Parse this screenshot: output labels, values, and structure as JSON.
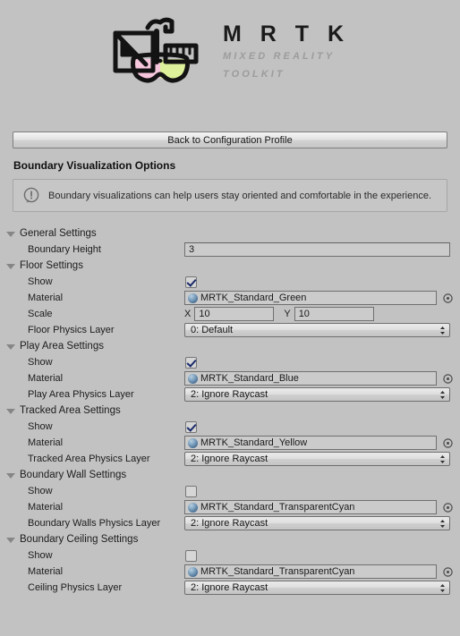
{
  "header": {
    "logo_icon": "mrtk-logo-icon",
    "wordmark": "M R T K",
    "tagline_line1": "MIXED REALITY",
    "tagline_line2": "TOOLKIT"
  },
  "toolbar": {
    "back_button_label": "Back to Configuration Profile"
  },
  "page_title": "Boundary Visualization Options",
  "help": {
    "icon": "info-exclamation-icon",
    "message": "Boundary visualizations can help users stay oriented and comfortable in the experience."
  },
  "sections": [
    {
      "title": "General Settings",
      "rows": [
        {
          "label": "Boundary Height",
          "type": "text",
          "value": "3"
        }
      ]
    },
    {
      "title": "Floor Settings",
      "rows": [
        {
          "label": "Show",
          "type": "checkbox",
          "checked": true
        },
        {
          "label": "Material",
          "type": "object",
          "value": "MRTK_Standard_Green"
        },
        {
          "label": "Scale",
          "type": "vector2",
          "x_label": "X",
          "x_value": "10",
          "y_label": "Y",
          "y_value": "10"
        },
        {
          "label": "Floor Physics Layer",
          "type": "dropdown",
          "value": "0: Default"
        }
      ]
    },
    {
      "title": "Play Area Settings",
      "rows": [
        {
          "label": "Show",
          "type": "checkbox",
          "checked": true
        },
        {
          "label": "Material",
          "type": "object",
          "value": "MRTK_Standard_Blue"
        },
        {
          "label": "Play Area Physics Layer",
          "type": "dropdown",
          "value": "2: Ignore Raycast"
        }
      ]
    },
    {
      "title": "Tracked Area Settings",
      "rows": [
        {
          "label": "Show",
          "type": "checkbox",
          "checked": true
        },
        {
          "label": "Material",
          "type": "object",
          "value": "MRTK_Standard_Yellow"
        },
        {
          "label": "Tracked Area Physics Layer",
          "type": "dropdown",
          "value": "2: Ignore Raycast"
        }
      ]
    },
    {
      "title": "Boundary Wall Settings",
      "rows": [
        {
          "label": "Show",
          "type": "checkbox",
          "checked": false
        },
        {
          "label": "Material",
          "type": "object",
          "value": "MRTK_Standard_TransparentCyan"
        },
        {
          "label": "Boundary Walls Physics Layer",
          "type": "dropdown",
          "value": "2: Ignore Raycast"
        }
      ]
    },
    {
      "title": "Boundary Ceiling Settings",
      "rows": [
        {
          "label": "Show",
          "type": "checkbox",
          "checked": false
        },
        {
          "label": "Material",
          "type": "object",
          "value": "MRTK_Standard_TransparentCyan"
        },
        {
          "label": "Ceiling Physics Layer",
          "type": "dropdown",
          "value": "2: Ignore Raycast"
        }
      ]
    }
  ],
  "colors": {
    "background": "#c2c2c2",
    "field_background": "#cbcbcb",
    "checkmark": "#1b2a6b"
  }
}
